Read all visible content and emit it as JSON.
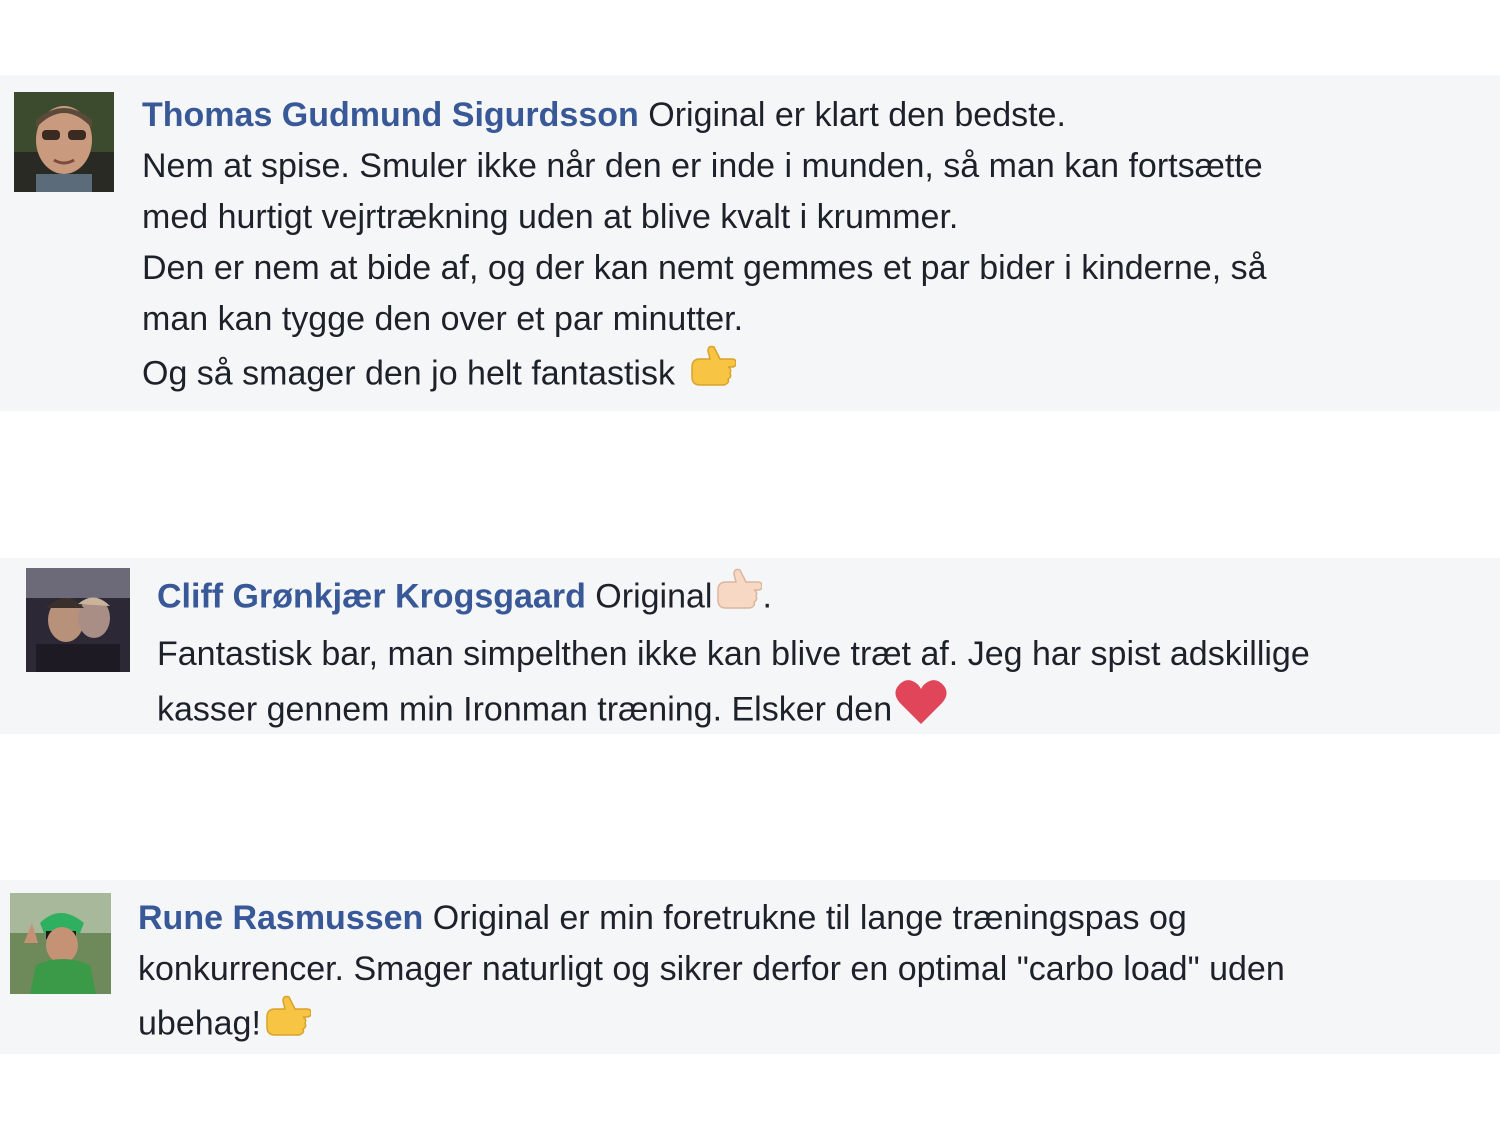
{
  "comments": [
    {
      "author": "Thomas Gudmund Sigurdsson",
      "first_line_text": "Original er klart den bedste.",
      "lines": [
        "Nem at spise. Smuler ikke når den er inde i munden, så man kan fortsætte",
        "med hurtigt vejrtrækning uden at blive kvalt i krummer.",
        "Den er nem at bide af, og der kan nemt gemmes et par bider i kinderne, så",
        "man kan tygge den over et par minutter.",
        "Og så smager den jo helt fantastisk"
      ],
      "trailing_emoji": "thumbs-point-right-icon"
    },
    {
      "author": "Cliff Grønkjær Krogsgaard",
      "first_line_text": "Original",
      "first_line_suffix": ".",
      "lines": [
        "Fantastisk bar, man simpelthen ikke kan blive træt af. Jeg har spist adskillige",
        "kasser gennem min Ironman træning. Elsker den"
      ],
      "trailing_emoji": "heart-icon"
    },
    {
      "author": "Rune Rasmussen",
      "first_line_text": "Original er min foretrukne til lange træningspas og",
      "lines": [
        "konkurrencer. Smager naturligt og sikrer derfor en optimal \"carbo load\" uden",
        "ubehag!"
      ],
      "trailing_emoji": "thumbs-point-right-icon"
    }
  ],
  "colors": {
    "author_link": "#385898",
    "body_text": "#1d2129",
    "comment_background": "#f5f6f8",
    "heart": "#e0455a",
    "hand_yellow": "#f7c543",
    "hand_light": "#f6d8c4"
  }
}
